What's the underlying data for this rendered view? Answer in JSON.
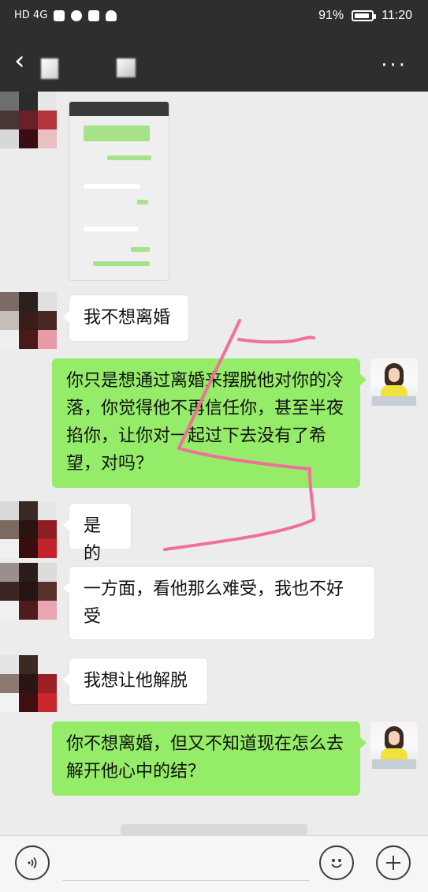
{
  "status_bar": {
    "network": "HD 4G",
    "battery_percent": "91%",
    "battery_level": 0.91,
    "time": "11:20",
    "icons": [
      "hd-icon",
      "signal-icon",
      "wifi-icon",
      "app-notification-icon",
      "chat-notification-icon",
      "baidu-icon",
      "cloud-icon",
      "battery-icon"
    ]
  },
  "header": {
    "back_icon": "chevron-left-icon",
    "more_icon": "more-dots-icon"
  },
  "messages": [
    {
      "side": "left",
      "type": "image",
      "content": "chat-screenshot"
    },
    {
      "side": "left",
      "type": "text",
      "text": "我不想离婚"
    },
    {
      "side": "right",
      "type": "text",
      "text": "你只是想通过离婚来摆脱他对你的冷落，你觉得他不再信任你，甚至半夜掐你，让你对一起过下去没有了希望，对吗？"
    },
    {
      "side": "left",
      "type": "text",
      "text": "是的"
    },
    {
      "side": "left",
      "type": "text",
      "text": "一方面，看他那么难受，我也不好受"
    },
    {
      "side": "left",
      "type": "text",
      "text": "我想让他解脱"
    },
    {
      "side": "right",
      "type": "text",
      "text": "你不想离婚，但又不知道现在怎么去解开他心中的结？"
    }
  ],
  "input_bar": {
    "voice_icon": "voice-icon",
    "emoji_icon": "emoji-icon",
    "plus_icon": "plus-icon"
  },
  "colors": {
    "bar_bg": "#2e2e2e",
    "chat_bg": "#ececec",
    "my_bubble": "#95ec69",
    "their_bubble": "#ffffff",
    "annotation": "#f0709a"
  }
}
